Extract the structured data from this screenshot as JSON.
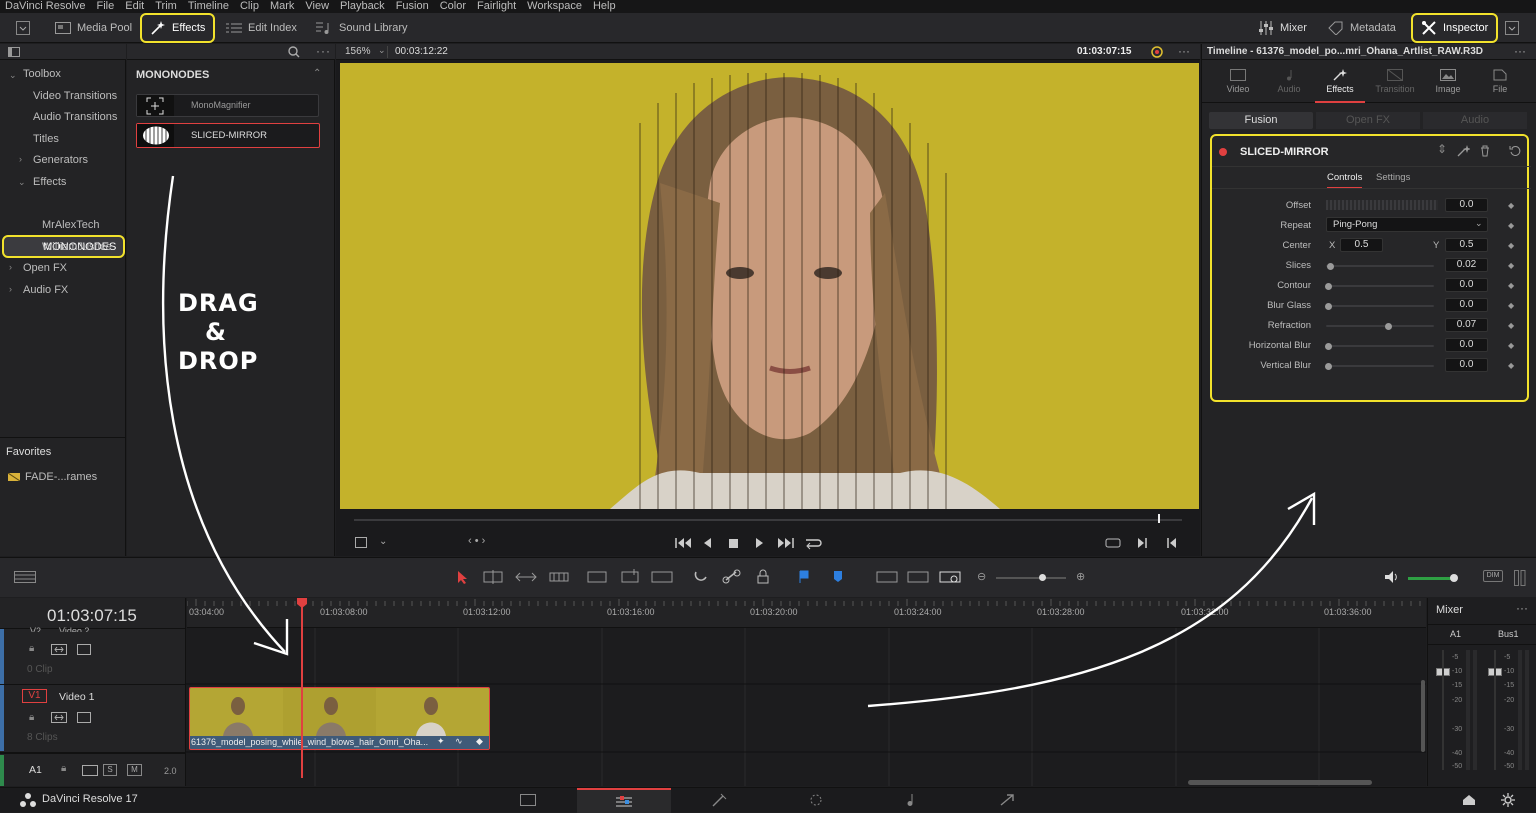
{
  "menu": [
    "DaVinci Resolve",
    "File",
    "Edit",
    "Trim",
    "Timeline",
    "Clip",
    "Mark",
    "View",
    "Playback",
    "Fusion",
    "Color",
    "Fairlight",
    "Workspace",
    "Help"
  ],
  "toolbar": {
    "media_pool": "Media Pool",
    "effects": "Effects",
    "edit_index": "Edit Index",
    "sound_library": "Sound Library",
    "mixer": "Mixer",
    "metadata": "Metadata",
    "inspector": "Inspector"
  },
  "toolbox": {
    "root": "Toolbox",
    "items": [
      "Video Transitions",
      "Audio Transitions",
      "Titles",
      "Generators",
      "Effects",
      "MONONODES",
      "MrAlexTech",
      "WilliamJustice",
      "Open FX",
      "Audio FX"
    ]
  },
  "favorites": {
    "title": "Favorites",
    "item": "FADE-...rames"
  },
  "nodes": {
    "title": "MONONODES",
    "items": [
      "MonoMagnifier",
      "SLICED-MIRROR"
    ]
  },
  "viewer": {
    "zoom": "156%",
    "duration": "00:03:12:22",
    "timecode": "01:03:07:15"
  },
  "annotation": {
    "line1": "DRAG",
    "line2": "&",
    "line3": "DROP"
  },
  "inspector": {
    "title": "Timeline - 61376_model_po...mri_Ohana_Artlist_RAW.R3D",
    "tabs": [
      "Video",
      "Audio",
      "Effects",
      "Transition",
      "Image",
      "File"
    ],
    "subtabs": [
      "Fusion",
      "Open FX",
      "Audio"
    ],
    "effect_name": "SLICED-MIRROR",
    "ctrl_tabs": [
      "Controls",
      "Settings"
    ],
    "params": [
      {
        "label": "Offset",
        "value": "0.0"
      },
      {
        "label": "Repeat",
        "value": "Ping-Pong"
      },
      {
        "label": "Center",
        "x_label": "X",
        "x": "0.5",
        "y_label": "Y",
        "y": "0.5"
      },
      {
        "label": "Slices",
        "value": "0.02",
        "level": 0.02
      },
      {
        "label": "Contour",
        "value": "0.0",
        "level": 0
      },
      {
        "label": "Blur Glass",
        "value": "0.0",
        "level": 0
      },
      {
        "label": "Refraction",
        "value": "0.07",
        "level": 0.56
      },
      {
        "label": "Horizontal Blur",
        "value": "0.0",
        "level": 0
      },
      {
        "label": "Vertical Blur",
        "value": "0.0",
        "level": 0
      }
    ]
  },
  "timeline": {
    "timecode": "01:03:07:15",
    "ruler": [
      "03:04:00",
      "01:03:08:00",
      "01:03:12:00",
      "01:03:16:00",
      "01:03:20:00",
      "01:03:24:00",
      "01:03:28:00",
      "01:03:32:00",
      "01:03:36:00"
    ],
    "tracks": {
      "v2": {
        "id": "V2",
        "name": "Video 2",
        "clips": "0 Clip"
      },
      "v1": {
        "id": "V1",
        "name": "Video 1",
        "clips": "8 Clips"
      },
      "a1": {
        "id": "A1",
        "vol": "2.0",
        "s": "S",
        "m": "M"
      }
    },
    "clip_name": "61376_model_posing_while_wind_blows_hair_Omri_Oha..."
  },
  "mixer": {
    "title": "Mixer",
    "channels": [
      "A1",
      "Bus1"
    ],
    "scale": [
      "-5",
      "-10",
      "-15",
      "-20",
      "-30",
      "-40",
      "-50"
    ]
  },
  "status": {
    "app": "DaVinci Resolve 17"
  },
  "colors": {
    "highlight": "#f2e22c",
    "accent_red": "#e04040",
    "viewer_bg": "#c9b52a"
  }
}
